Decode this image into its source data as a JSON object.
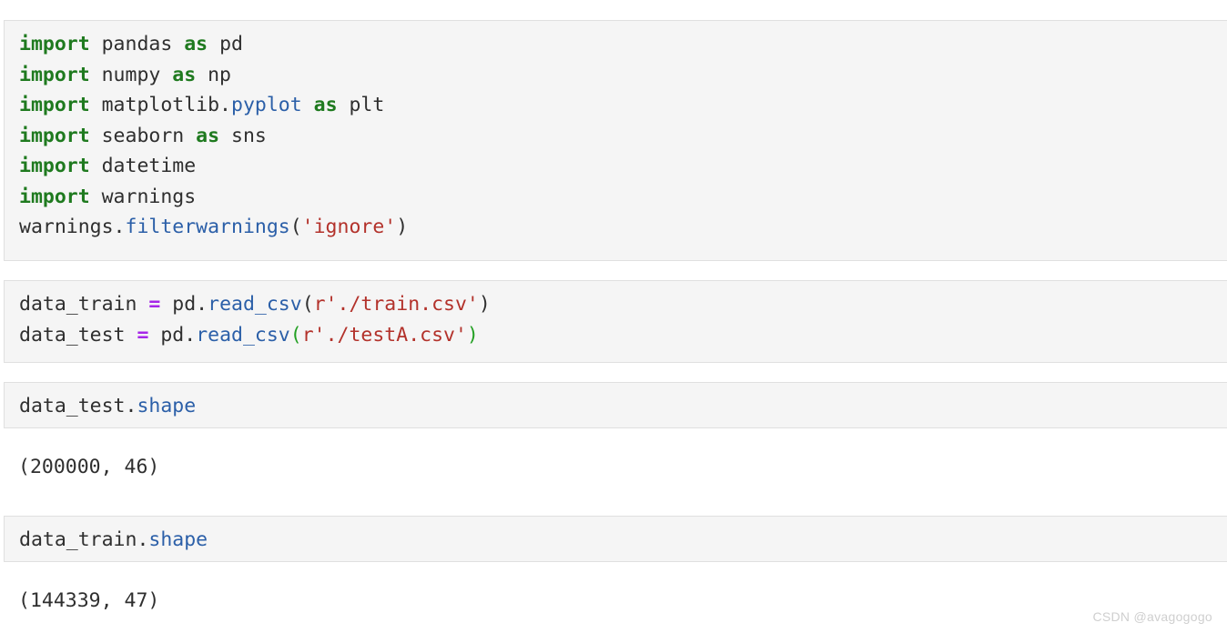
{
  "document": {
    "type": "jupyter-notebook",
    "background_color": "#ffffff",
    "cell_background_color": "#f5f5f5",
    "cell_border_color": "#e0e0e0"
  },
  "theme": {
    "keyword_color": "#1f7a1f",
    "function_color": "#2b5fa8",
    "string_color": "#b3322b",
    "operator_color": "#a626e8",
    "bracket_match_color": "#23a023",
    "text_color": "#2f2f2f",
    "watermark_color": "#cfcfcf"
  },
  "cells": [
    {
      "index": 1,
      "kind": "code",
      "lines": [
        {
          "tokens": [
            {
              "t": "import",
              "c": "kw"
            },
            {
              "t": " pandas ",
              "c": "plain"
            },
            {
              "t": "as",
              "c": "kw"
            },
            {
              "t": " pd",
              "c": "plain"
            }
          ]
        },
        {
          "tokens": [
            {
              "t": "import",
              "c": "kw"
            },
            {
              "t": " numpy ",
              "c": "plain"
            },
            {
              "t": "as",
              "c": "kw"
            },
            {
              "t": " np",
              "c": "plain"
            }
          ]
        },
        {
          "tokens": [
            {
              "t": "import",
              "c": "kw"
            },
            {
              "t": " matplotlib.",
              "c": "plain"
            },
            {
              "t": "pyplot",
              "c": "fn"
            },
            {
              "t": " ",
              "c": "plain"
            },
            {
              "t": "as",
              "c": "kw"
            },
            {
              "t": " plt",
              "c": "plain"
            }
          ]
        },
        {
          "tokens": [
            {
              "t": "import",
              "c": "kw"
            },
            {
              "t": " seaborn ",
              "c": "plain"
            },
            {
              "t": "as",
              "c": "kw"
            },
            {
              "t": " sns",
              "c": "plain"
            }
          ]
        },
        {
          "tokens": [
            {
              "t": "import",
              "c": "kw"
            },
            {
              "t": " datetime",
              "c": "plain"
            }
          ]
        },
        {
          "tokens": [
            {
              "t": "import",
              "c": "kw"
            },
            {
              "t": " warnings",
              "c": "plain"
            }
          ]
        },
        {
          "tokens": [
            {
              "t": "warnings.",
              "c": "plain"
            },
            {
              "t": "filterwarnings",
              "c": "fn"
            },
            {
              "t": "(",
              "c": "plain"
            },
            {
              "t": "'ignore'",
              "c": "str"
            },
            {
              "t": ")",
              "c": "plain"
            }
          ]
        }
      ],
      "output": null
    },
    {
      "index": 2,
      "kind": "code",
      "lines": [
        {
          "tokens": [
            {
              "t": "data_train ",
              "c": "plain"
            },
            {
              "t": "=",
              "c": "op"
            },
            {
              "t": " pd.",
              "c": "plain"
            },
            {
              "t": "read_csv",
              "c": "fn"
            },
            {
              "t": "(",
              "c": "plain"
            },
            {
              "t": "r'./train.csv'",
              "c": "str"
            },
            {
              "t": ")",
              "c": "plain"
            }
          ]
        },
        {
          "tokens": [
            {
              "t": "data_test ",
              "c": "plain"
            },
            {
              "t": "=",
              "c": "op"
            },
            {
              "t": " pd.",
              "c": "plain"
            },
            {
              "t": "read_csv",
              "c": "fn"
            },
            {
              "t": "(",
              "c": "bracket"
            },
            {
              "t": "r'./testA.csv'",
              "c": "str"
            },
            {
              "t": ")",
              "c": "bracket"
            }
          ]
        }
      ],
      "output": null
    },
    {
      "index": 3,
      "kind": "code",
      "lines": [
        {
          "tokens": [
            {
              "t": "data_test.",
              "c": "plain"
            },
            {
              "t": "shape",
              "c": "fn"
            }
          ]
        }
      ],
      "output": "(200000, 46)"
    },
    {
      "index": 4,
      "kind": "code",
      "lines": [
        {
          "tokens": [
            {
              "t": "data_train.",
              "c": "plain"
            },
            {
              "t": "shape",
              "c": "fn"
            }
          ]
        }
      ],
      "output": "(144339, 47)"
    }
  ],
  "watermark": {
    "text": "CSDN @avagogogo"
  }
}
